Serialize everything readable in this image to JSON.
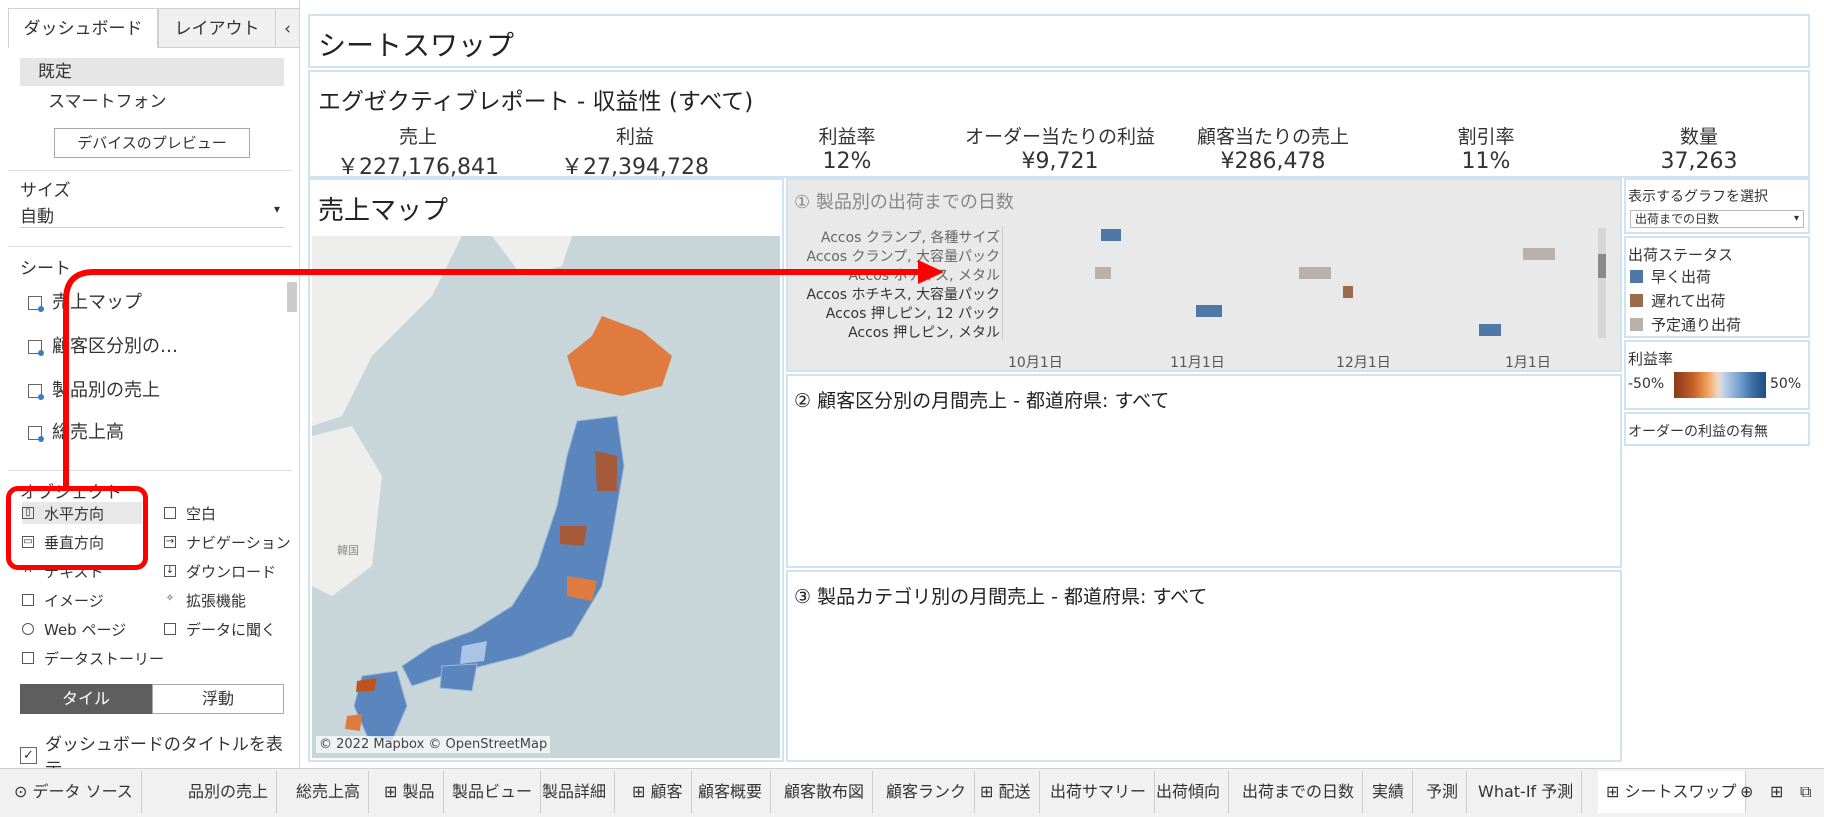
{
  "left_panel": {
    "tabs": [
      "ダッシュボード",
      "レイアウト"
    ],
    "collapse": "‹",
    "devices": [
      "既定",
      "スマートフォン"
    ],
    "preview_button": "デバイスのプレビュー",
    "size_label": "サイズ",
    "size_value": "自動",
    "sheets_label": "シート",
    "sheets": [
      "売上マップ",
      "顧客区分別の…",
      "製品別の売上",
      "総売上高"
    ],
    "objects_label": "オブジェクト",
    "objects_col1": [
      "水平方向",
      "垂直方向",
      "テキスト",
      "イメージ",
      "Web ページ",
      "データストーリー"
    ],
    "objects_col2": [
      "空白",
      "ナビゲーション",
      "ダウンロード",
      "拡張機能",
      "データに聞く"
    ],
    "mode_tile": "タイル",
    "mode_float": "浮動",
    "show_title": "ダッシュボードのタイトルを表示"
  },
  "dashboard": {
    "title": "シートスワップ",
    "report_title": "エグゼクティブレポート - 収益性 (すべて)",
    "kpis": [
      {
        "label": "売上",
        "value": "￥227,176,841"
      },
      {
        "label": "利益",
        "value": "￥27,394,728"
      },
      {
        "label": "利益率",
        "value": "12%"
      },
      {
        "label": "オーダー当たりの利益",
        "value": "¥9,721"
      },
      {
        "label": "顧客当たりの売上",
        "value": "¥286,478"
      },
      {
        "label": "割引率",
        "value": "11%"
      },
      {
        "label": "数量",
        "value": "37,263"
      }
    ],
    "map": {
      "title": "売上マップ",
      "korea_label": "韓国",
      "attribution": "© 2022 Mapbox © OpenStreetMap"
    },
    "chart1": {
      "title": "①  製品別の出荷までの日数",
      "rows": [
        "Accos クランプ, 各種サイズ",
        "Accos クランプ, 大容量パック",
        "Accos ホチキス, メタル",
        "Accos ホチキス, 大容量パック",
        "Accos 押しピン, 12 パック",
        "Accos 押しピン, メタル"
      ],
      "ticks": [
        "10月1日",
        "11月1日",
        "12月1日",
        "1月1日"
      ]
    },
    "chart2_title": "②  顧客区分別の月間売上 - 都道府県: すべて",
    "chart3_title": "③  製品カテゴリ別の月間売上 - 都道府県: すべて",
    "graph_select": {
      "label": "表示するグラフを選択",
      "value": "出荷までの日数"
    },
    "ship_status": {
      "label": "出荷ステータス",
      "items": [
        {
          "name": "早く出荷",
          "color": "#4e79a7"
        },
        {
          "name": "遅れて出荷",
          "color": "#9c6b4e"
        },
        {
          "name": "予定通り出荷",
          "color": "#bab0ac"
        }
      ]
    },
    "profit_rate": {
      "label": "利益率",
      "min": "-50%",
      "max": "50%"
    },
    "order_profit_label": "オーダーの利益の有無"
  },
  "tabs": [
    "データ ソース",
    "品別の売上",
    "総売上高",
    "製品",
    "製品ビュー",
    "製品詳細",
    "顧客",
    "顧客概要",
    "顧客散布図",
    "顧客ランク",
    "配送",
    "出荷サマリー",
    "出荷傾向",
    "出荷までの日数",
    "実績",
    "予測",
    "What-If 予測",
    "シートスワップ"
  ],
  "colors": {
    "accent_red": "#ff0000",
    "frame_blue": "#cfe3f2",
    "map_water": "#c8d6da"
  }
}
